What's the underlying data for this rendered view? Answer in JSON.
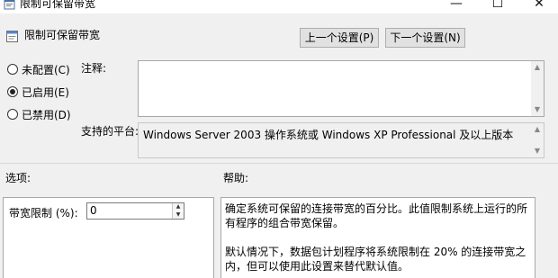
{
  "window": {
    "title": "限制可保留带宽",
    "minimize_glyph": "—",
    "maximize_glyph": "☐",
    "close_glyph": "✕"
  },
  "header": {
    "title": "限制可保留带宽",
    "prev_button": "上一个设置(P)",
    "next_button": "下一个设置(N)"
  },
  "state": {
    "options": [
      {
        "label": "未配置(C)",
        "checked": false
      },
      {
        "label": "已启用(E)",
        "checked": true
      },
      {
        "label": "已禁用(D)",
        "checked": false
      }
    ]
  },
  "comment": {
    "label": "注释:",
    "value": ""
  },
  "supported": {
    "label": "支持的平台:",
    "value": "Windows Server 2003 操作系统或 Windows XP Professional 及以上版本"
  },
  "options_section": {
    "label": "选项:",
    "bandwidth_label": "带宽限制 (%):",
    "bandwidth_value": "0"
  },
  "help_section": {
    "label": "帮助:",
    "paragraph1": "确定系统可保留的连接带宽的百分比。此值限制系统上运行的所有程序的组合带宽保留。",
    "paragraph2": "默认情况下，数据包计划程序将系统限制在 20% 的连接带宽之内，但可以使用此设置来替代默认值。"
  },
  "icons": {
    "title_icon": "policy-settings-icon",
    "header_icon": "policy-page-icon"
  }
}
